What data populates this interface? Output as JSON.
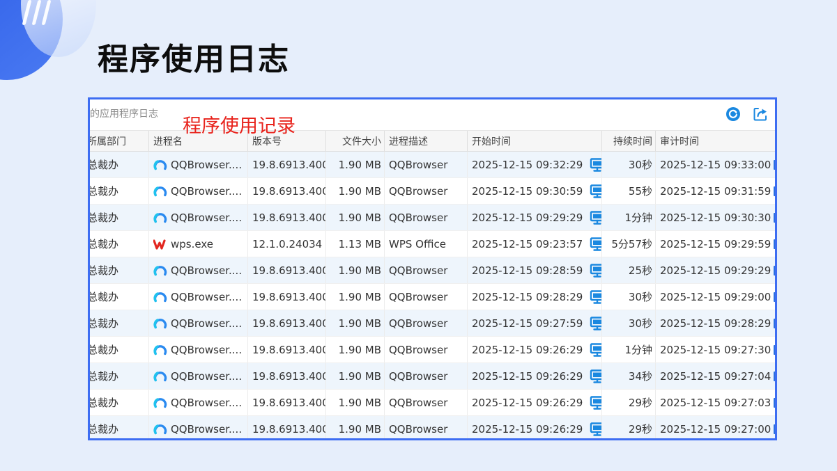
{
  "page": {
    "title": "程序使用日志"
  },
  "toolbar": {
    "search_placeholder": "的应用程序日志",
    "annotation": "程序使用记录",
    "refresh_icon": "refresh-icon",
    "export_icon": "export-icon"
  },
  "colors": {
    "accent": "#3d6df2",
    "annotation": "#e8231c",
    "row_alt": "#eef5fc",
    "icon_blue": "#1a88e0"
  },
  "table": {
    "columns": [
      "所属部门",
      "进程名",
      "版本号",
      "文件大小",
      "进程描述",
      "开始时间",
      "持续时间",
      "审计时间"
    ],
    "rows": [
      {
        "dept": "总裁办",
        "process": "QQBrowser....",
        "icon": "qqbrowser-icon",
        "version": "19.8.6913.400",
        "size": "1.90 MB",
        "desc": "QQBrowser",
        "start": "2025-12-15 09:32:29",
        "duration": "30秒",
        "audit": "2025-12-15 09:33:00"
      },
      {
        "dept": "总裁办",
        "process": "QQBrowser....",
        "icon": "qqbrowser-icon",
        "version": "19.8.6913.400",
        "size": "1.90 MB",
        "desc": "QQBrowser",
        "start": "2025-12-15 09:30:59",
        "duration": "55秒",
        "audit": "2025-12-15 09:31:59"
      },
      {
        "dept": "总裁办",
        "process": "QQBrowser....",
        "icon": "qqbrowser-icon",
        "version": "19.8.6913.400",
        "size": "1.90 MB",
        "desc": "QQBrowser",
        "start": "2025-12-15 09:29:29",
        "duration": "1分钟",
        "audit": "2025-12-15 09:30:30"
      },
      {
        "dept": "总裁办",
        "process": "wps.exe",
        "icon": "wps-icon",
        "version": "12.1.0.24034",
        "size": "1.13 MB",
        "desc": "WPS Office",
        "start": "2025-12-15 09:23:57",
        "duration": "5分57秒",
        "audit": "2025-12-15 09:29:59"
      },
      {
        "dept": "总裁办",
        "process": "QQBrowser....",
        "icon": "qqbrowser-icon",
        "version": "19.8.6913.400",
        "size": "1.90 MB",
        "desc": "QQBrowser",
        "start": "2025-12-15 09:28:59",
        "duration": "25秒",
        "audit": "2025-12-15 09:29:29"
      },
      {
        "dept": "总裁办",
        "process": "QQBrowser....",
        "icon": "qqbrowser-icon",
        "version": "19.8.6913.400",
        "size": "1.90 MB",
        "desc": "QQBrowser",
        "start": "2025-12-15 09:28:29",
        "duration": "30秒",
        "audit": "2025-12-15 09:29:00"
      },
      {
        "dept": "总裁办",
        "process": "QQBrowser....",
        "icon": "qqbrowser-icon",
        "version": "19.8.6913.400",
        "size": "1.90 MB",
        "desc": "QQBrowser",
        "start": "2025-12-15 09:27:59",
        "duration": "30秒",
        "audit": "2025-12-15 09:28:29"
      },
      {
        "dept": "总裁办",
        "process": "QQBrowser....",
        "icon": "qqbrowser-icon",
        "version": "19.8.6913.400",
        "size": "1.90 MB",
        "desc": "QQBrowser",
        "start": "2025-12-15 09:26:29",
        "duration": "1分钟",
        "audit": "2025-12-15 09:27:30"
      },
      {
        "dept": "总裁办",
        "process": "QQBrowser....",
        "icon": "qqbrowser-icon",
        "version": "19.8.6913.400",
        "size": "1.90 MB",
        "desc": "QQBrowser",
        "start": "2025-12-15 09:26:29",
        "duration": "34秒",
        "audit": "2025-12-15 09:27:04"
      },
      {
        "dept": "总裁办",
        "process": "QQBrowser....",
        "icon": "qqbrowser-icon",
        "version": "19.8.6913.400",
        "size": "1.90 MB",
        "desc": "QQBrowser",
        "start": "2025-12-15 09:26:29",
        "duration": "29秒",
        "audit": "2025-12-15 09:27:03"
      },
      {
        "dept": "总裁办",
        "process": "QQBrowser....",
        "icon": "qqbrowser-icon",
        "version": "19.8.6913.400",
        "size": "1.90 MB",
        "desc": "QQBrowser",
        "start": "2025-12-15 09:26:29",
        "duration": "29秒",
        "audit": "2025-12-15 09:27:00"
      }
    ]
  }
}
